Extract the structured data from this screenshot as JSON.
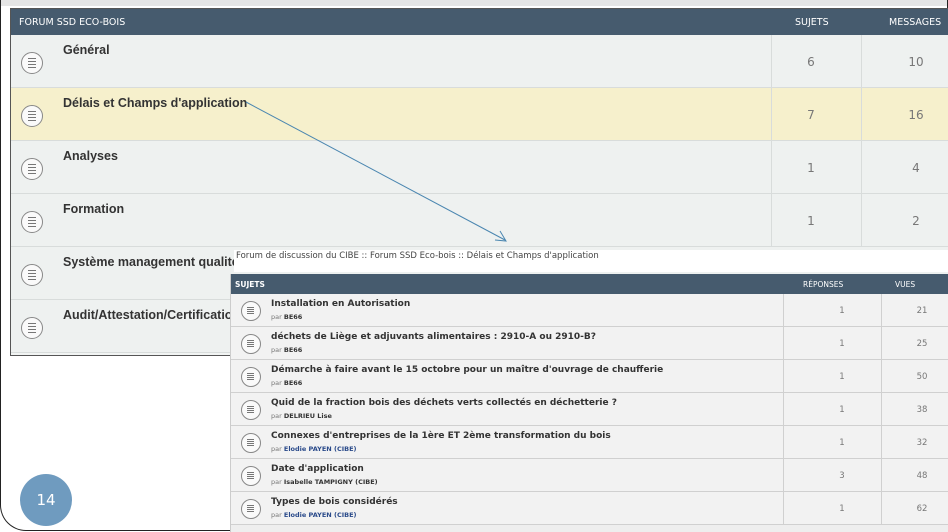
{
  "forum": {
    "header": {
      "title": "FORUM SSD ECO-BOIS",
      "col_topics": "SUJETS",
      "col_messages": "MESSAGES"
    },
    "rows": [
      {
        "name": "Général",
        "topics": "6",
        "messages": "10"
      },
      {
        "name": "Délais et Champs d'application",
        "topics": "7",
        "messages": "16"
      },
      {
        "name": "Analyses",
        "topics": "1",
        "messages": "4"
      },
      {
        "name": "Formation",
        "topics": "1",
        "messages": "2"
      },
      {
        "name": "Système management qualité",
        "topics": "",
        "messages": ""
      },
      {
        "name": "Audit/Attestation/Certification",
        "topics": "",
        "messages": ""
      }
    ]
  },
  "breadcrumb": "Forum de discussion du CIBE :: Forum SSD Eco-bois :: Délais et Champs d'application",
  "topics": {
    "header": {
      "title": "SUJETS",
      "col_replies": "RÉPONSES",
      "col_views": "VUES"
    },
    "rows": [
      {
        "title": "Installation en Autorisation",
        "by_prefix": "par",
        "author": "BE66",
        "replies": "1",
        "views": "21"
      },
      {
        "title": "déchets de Liège et adjuvants alimentaires : 2910-A ou 2910-B?",
        "by_prefix": "par",
        "author": "BE66",
        "replies": "1",
        "views": "25"
      },
      {
        "title": "Démarche à faire avant le 15 octobre pour un maître d'ouvrage de chaufferie",
        "by_prefix": "par",
        "author": "BE66",
        "replies": "1",
        "views": "50"
      },
      {
        "title": "Quid de la fraction bois des déchets verts collectés en déchetterie ?",
        "by_prefix": "par",
        "author": "DELRIEU Lise",
        "replies": "1",
        "views": "38"
      },
      {
        "title": "Connexes d'entreprises de la 1ère ET 2ème transformation du bois",
        "by_prefix": "par",
        "author": "Elodie PAYEN (CIBE)",
        "replies": "1",
        "views": "32"
      },
      {
        "title": "Date d'application",
        "by_prefix": "par",
        "author": "Isabelle TAMPIGNY (CIBE)",
        "replies": "3",
        "views": "48"
      },
      {
        "title": "Types de bois considérés",
        "by_prefix": "par",
        "author": "Elodie PAYEN (CIBE)",
        "replies": "1",
        "views": "62"
      }
    ]
  },
  "page_number": "14",
  "colors": {
    "header_bg": "#465b6e",
    "highlight_row": "#f6f0cc",
    "badge": "#6f9bbf",
    "arrow": "#4a86b0"
  }
}
